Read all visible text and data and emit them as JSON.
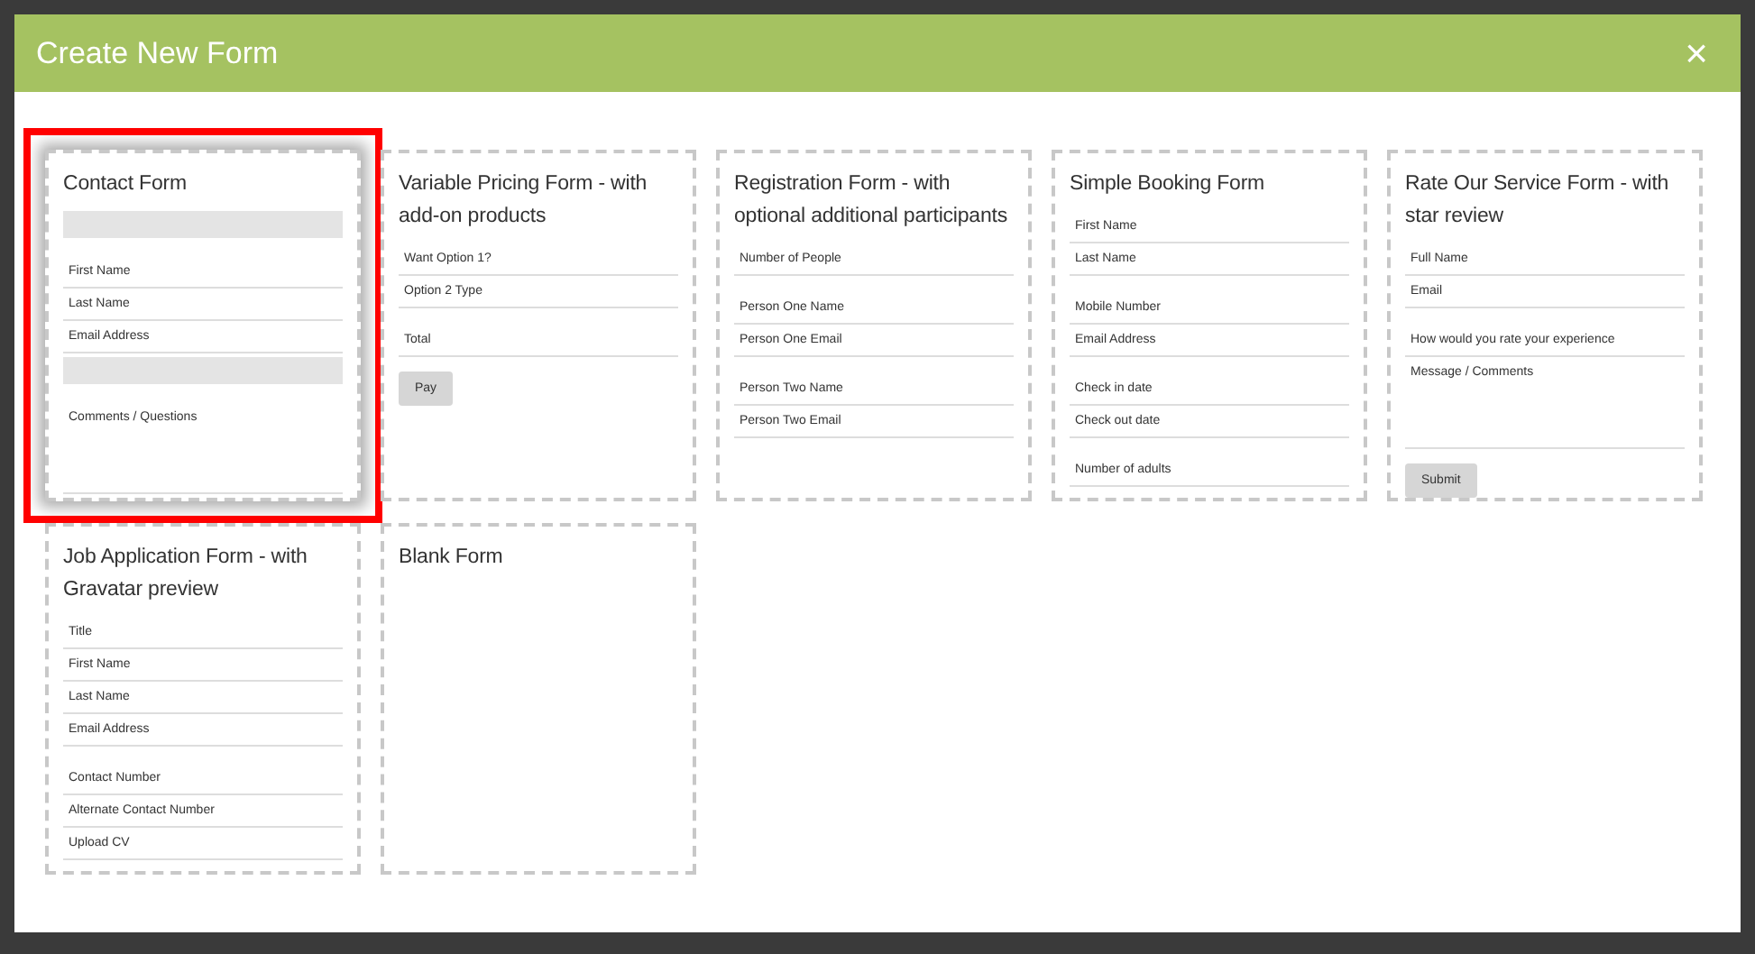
{
  "dialog": {
    "title": "Create New Form",
    "close": "×"
  },
  "templates": [
    {
      "title": "Contact Form",
      "selected": true,
      "items": [
        {
          "kind": "bar"
        },
        {
          "kind": "field",
          "label": "First Name"
        },
        {
          "kind": "field",
          "label": "Last Name"
        },
        {
          "kind": "field",
          "label": "Email Address"
        },
        {
          "kind": "bar"
        },
        {
          "kind": "area",
          "label": "Comments / Questions"
        }
      ]
    },
    {
      "title": "Variable Pricing Form - with add-on products",
      "selected": false,
      "items": [
        {
          "kind": "field",
          "label": "Want Option 1?"
        },
        {
          "kind": "field",
          "label": "Option 2 Type"
        },
        {
          "kind": "spaced",
          "label": "Total"
        },
        {
          "kind": "button",
          "label": "Pay"
        }
      ]
    },
    {
      "title": "Registration Form - with optional additional participants",
      "selected": false,
      "items": [
        {
          "kind": "field",
          "label": "Number of People"
        },
        {
          "kind": "spaced",
          "label": "Person One Name"
        },
        {
          "kind": "field",
          "label": "Person One Email"
        },
        {
          "kind": "spaced",
          "label": "Person Two Name"
        },
        {
          "kind": "field",
          "label": "Person Two Email"
        }
      ]
    },
    {
      "title": "Simple Booking Form",
      "selected": false,
      "items": [
        {
          "kind": "field",
          "label": "First Name"
        },
        {
          "kind": "field",
          "label": "Last Name"
        },
        {
          "kind": "spaced",
          "label": "Mobile Number"
        },
        {
          "kind": "field",
          "label": "Email Address"
        },
        {
          "kind": "spaced",
          "label": "Check in date"
        },
        {
          "kind": "field",
          "label": "Check out date"
        },
        {
          "kind": "spaced",
          "label": "Number of adults"
        }
      ]
    },
    {
      "title": "Rate Our Service Form - with star review",
      "selected": false,
      "items": [
        {
          "kind": "field",
          "label": "Full Name"
        },
        {
          "kind": "field",
          "label": "Email"
        },
        {
          "kind": "spaced",
          "label": "How would you rate your experience"
        },
        {
          "kind": "area",
          "label": "Message / Comments"
        },
        {
          "kind": "button",
          "label": "Submit"
        }
      ]
    },
    {
      "title": "Job Application Form - with Gravatar preview",
      "selected": false,
      "items": [
        {
          "kind": "field",
          "label": "Title"
        },
        {
          "kind": "field",
          "label": "First Name"
        },
        {
          "kind": "field",
          "label": "Last Name"
        },
        {
          "kind": "field",
          "label": "Email Address"
        },
        {
          "kind": "spaced",
          "label": "Contact Number"
        },
        {
          "kind": "field",
          "label": "Alternate Contact Number"
        },
        {
          "kind": "field",
          "label": "Upload CV"
        }
      ]
    },
    {
      "title": "Blank Form",
      "selected": false
    }
  ]
}
